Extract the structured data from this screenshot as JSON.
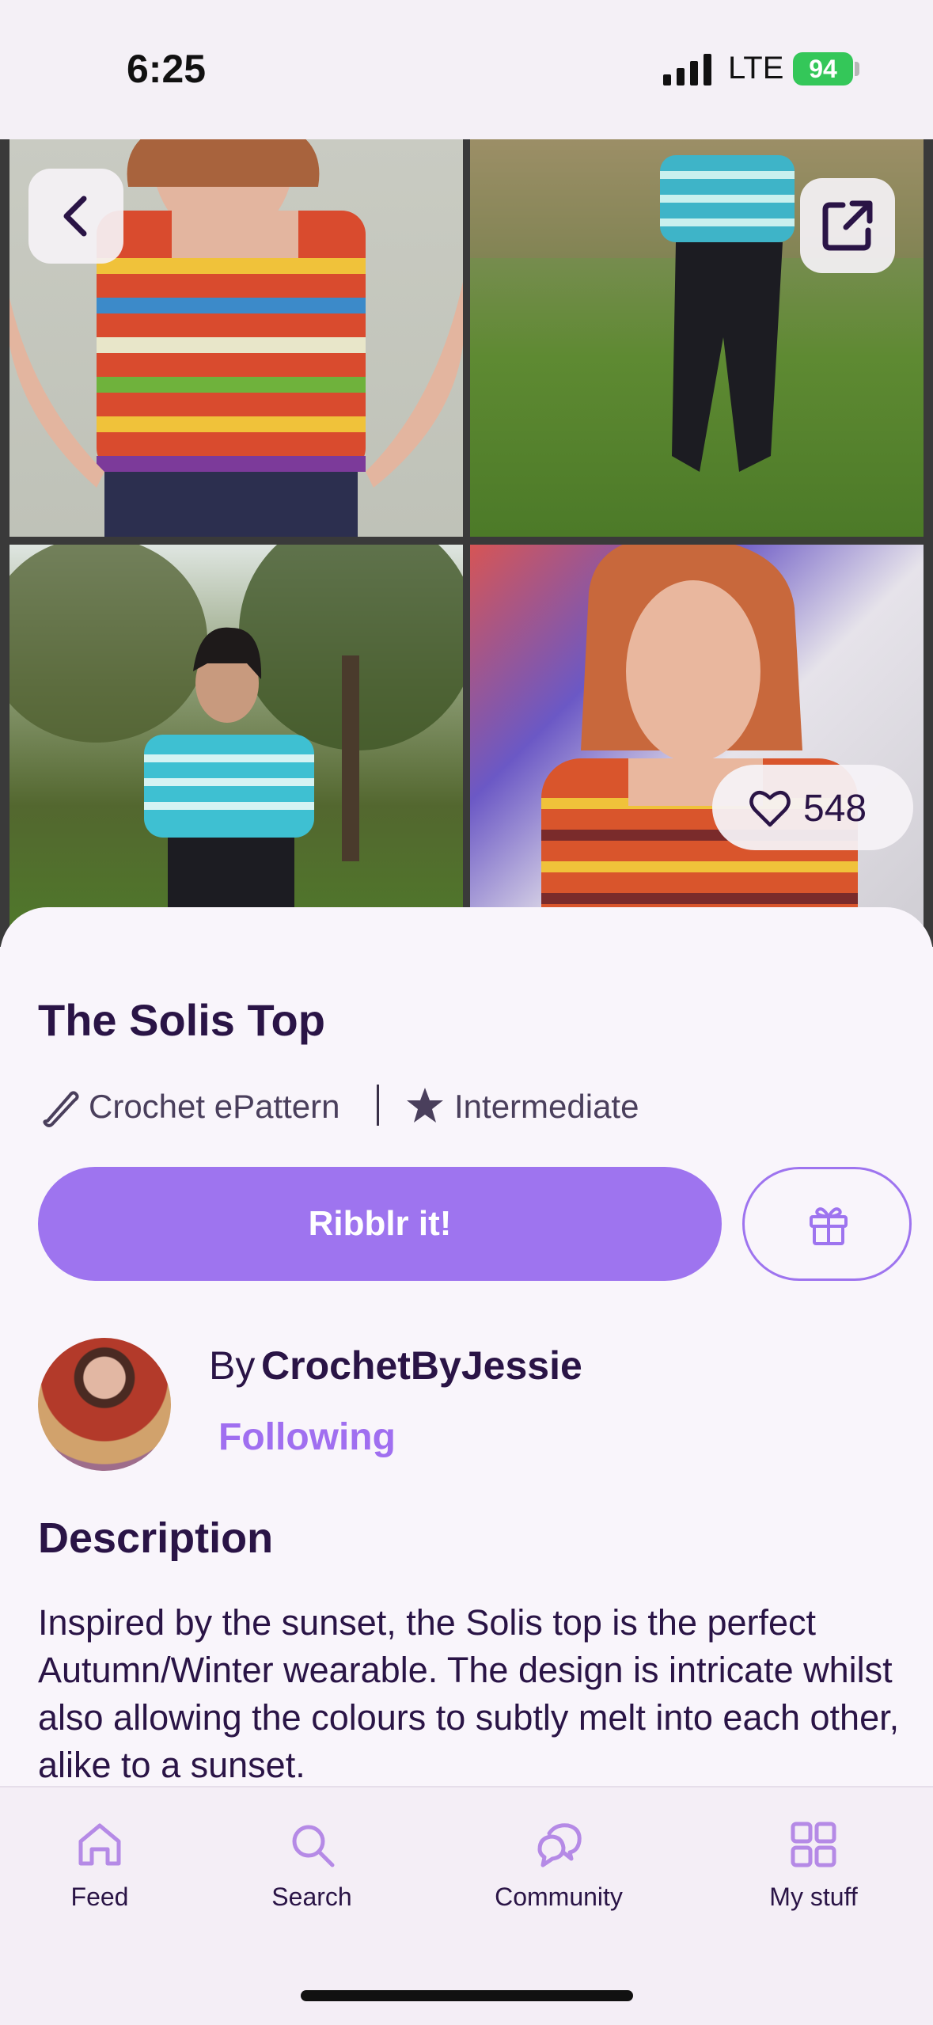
{
  "status_bar": {
    "time": "6:25",
    "network": "LTE",
    "battery": "94"
  },
  "gallery": {
    "likes": "548",
    "page_count": 7,
    "active_page": 5
  },
  "pattern": {
    "title": "The Solis Top",
    "type": "Crochet ePattern",
    "difficulty": "Intermediate",
    "cta_label": "Ribblr it!"
  },
  "designer": {
    "by_label": "By",
    "name": "CrochetByJessie",
    "follow_status": "Following"
  },
  "description": {
    "heading": "Description",
    "body": "Inspired by the sunset, the Solis top is the perfect Autumn/Winter wearable. The design is intricate whilst also allowing the colours to subtly melt into each other, alike to a sunset."
  },
  "tabbar": {
    "items": [
      {
        "label": "Feed",
        "icon": "home-icon"
      },
      {
        "label": "Search",
        "icon": "search-icon"
      },
      {
        "label": "Community",
        "icon": "chat-bubbles-icon"
      },
      {
        "label": "My stuff",
        "icon": "grid-icon"
      }
    ]
  },
  "colors": {
    "accent": "#9e74ef",
    "text": "#2a1446",
    "background": "#f9f5fb"
  }
}
